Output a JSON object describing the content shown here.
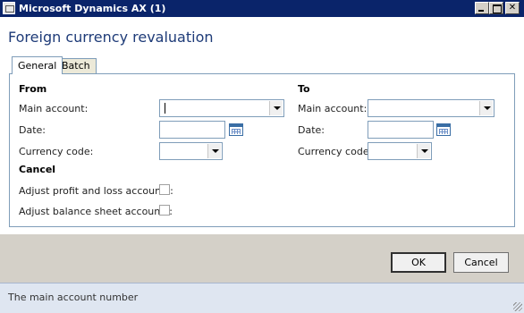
{
  "window": {
    "title": "Microsoft Dynamics AX (1)"
  },
  "page": {
    "title": "Foreign currency revaluation"
  },
  "tabs": [
    {
      "label": "General",
      "active": true
    },
    {
      "label": "Batch",
      "active": false
    }
  ],
  "from": {
    "heading": "From",
    "main_account_label": "Main account:",
    "main_account_value": "",
    "date_label": "Date:",
    "date_value": "",
    "currency_code_label": "Currency code:",
    "currency_code_value": ""
  },
  "to": {
    "heading": "To",
    "main_account_label": "Main account:",
    "main_account_value": "",
    "date_label": "Date:",
    "date_value": "",
    "currency_code_label": "Currency code:",
    "currency_code_value": ""
  },
  "cancel": {
    "heading": "Cancel",
    "adjust_pl_label": "Adjust profit and loss accounts:",
    "adjust_pl_checked": false,
    "adjust_bs_label": "Adjust balance sheet accounts:",
    "adjust_bs_checked": false
  },
  "buttons": {
    "ok": "OK",
    "cancel": "Cancel"
  },
  "status": {
    "message": "The main account number"
  },
  "colors": {
    "title_bar": "#0a246a",
    "page_title": "#1e3b78",
    "footer": "#d4d0c8",
    "status_bar": "#dfe6f1"
  }
}
